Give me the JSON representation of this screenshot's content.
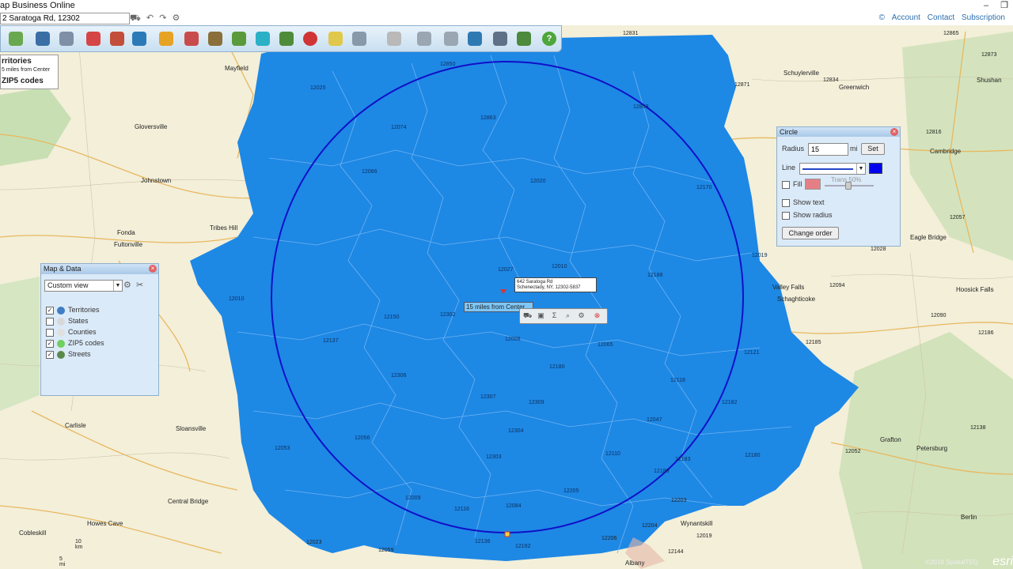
{
  "app_title": "ap Business Online",
  "window_controls": {
    "minimize": "–",
    "restore": "❐"
  },
  "address_bar": {
    "value": "2 Saratoga Rd, 12302"
  },
  "top_links": {
    "account": "Account",
    "contact": "Contact",
    "subscription": "Subscription"
  },
  "legend": {
    "line1": "rritories",
    "line2": "5 miles from Center",
    "line3": "ZIP5 codes"
  },
  "map_data_panel": {
    "title": "Map & Data",
    "view_value": "Custom view",
    "layers": [
      {
        "label": "Territories",
        "checked": true,
        "icon": "territories-icon"
      },
      {
        "label": "States",
        "checked": false,
        "icon": "states-icon"
      },
      {
        "label": "Counties",
        "checked": false,
        "icon": "counties-icon"
      },
      {
        "label": "ZIP5 codes",
        "checked": true,
        "icon": "zip-codes-icon"
      },
      {
        "label": "Streets",
        "checked": true,
        "icon": "streets-icon"
      }
    ]
  },
  "circle_panel": {
    "title": "Circle",
    "radius_label": "Radius",
    "radius_value": "15",
    "unit": "mi",
    "set_label": "Set",
    "line_label": "Line",
    "fill_label": "Fill",
    "trans_label": "Trans 50%",
    "show_text_label": "Show text",
    "show_radius_label": "Show radius",
    "change_order_label": "Change order",
    "line_color": "#0000ee",
    "fill_color": "#e57f86"
  },
  "callout": {
    "line1": "642 Saratoga Rd",
    "line2": "Schenectady, NY, 12302-5837"
  },
  "radius_label": "15 miles from Center",
  "scale": {
    "km": "10 km",
    "mi": "5 mi"
  },
  "attribution": "©2019 SpatialTEQ",
  "esri": "esri",
  "territory_color": "#1e88e5",
  "zip_labels": [
    "12850",
    "12831",
    "12865",
    "12873",
    "12025",
    "12803",
    "12074",
    "12863",
    "12834",
    "12871",
    "12816",
    "12086",
    "12020",
    "12170",
    "12828",
    "12057",
    "12019",
    "12154",
    "12028",
    "12027",
    "12010",
    "12188",
    "12094",
    "12010",
    "12302",
    "12150",
    "12065",
    "12090",
    "12137",
    "12008",
    "12180",
    "12121",
    "12185",
    "12306",
    "12118",
    "12186",
    "12182",
    "12138",
    "12307",
    "12309",
    "12047",
    "12053",
    "12056",
    "12304",
    "12110",
    "12180",
    "12052",
    "12303",
    "12183",
    "12189",
    "12009",
    "12205",
    "12084",
    "12203",
    "12204",
    "12116",
    "12206",
    "12136",
    "12192",
    "12059",
    "12023",
    "12019",
    "12144"
  ],
  "towns": [
    "Mayfield",
    "Schuylerville",
    "Greenwich",
    "Shushan",
    "Gloversville",
    "Cambridge",
    "Johnstown",
    "Fonda",
    "Fultonville",
    "Tribes Hill",
    "Schaghticoke",
    "Valley Falls",
    "Hoosick Falls",
    "Eagle Bridge",
    "Carlisle",
    "Sloansville",
    "Central Bridge",
    "Cobleskill",
    "Howes Cave",
    "Petersburg",
    "Berlin",
    "Grafton",
    "Albany",
    "Wynantskill"
  ]
}
